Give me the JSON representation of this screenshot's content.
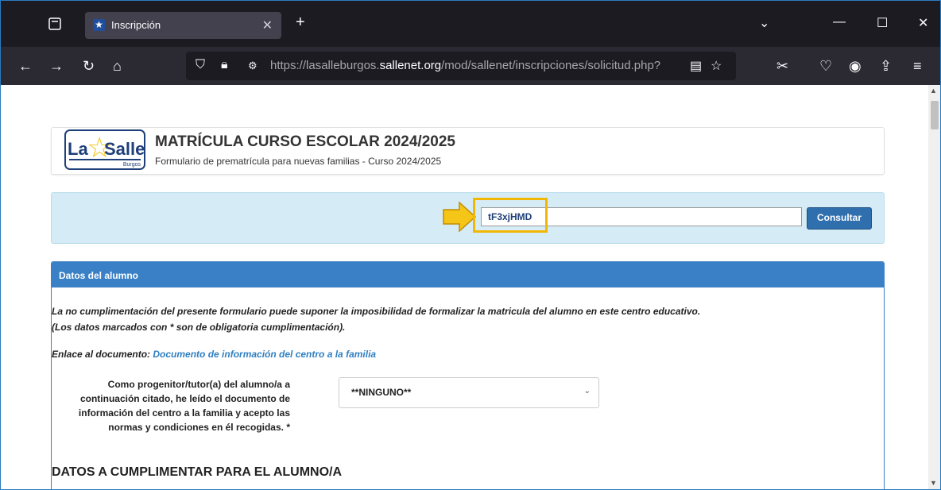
{
  "browser": {
    "tab_title": "Inscripción",
    "tab_favicon": "★",
    "url_prefix": "https://lasalleburgos.",
    "url_domain": "sallenet.org",
    "url_path": "/mod/sallenet/inscripciones/solicitud.php?"
  },
  "header": {
    "logo_la": "La",
    "logo_salle": "Salle",
    "logo_burgos": "Burgos",
    "title": "MATRÍCULA CURSO ESCOLAR 2024/2025",
    "subtitle": "Formulario de prematrícula para nuevas familias - Curso 2024/2025"
  },
  "search": {
    "code_value": "tF3xjHMD",
    "button_label": "Consultar"
  },
  "section": {
    "title": "Datos del alumno",
    "notice_line1": "La no cumplimentación del presente formulario puede suponer la imposibilidad de formalizar la matricula del alumno en este centro educativo.",
    "notice_line2": "(Los datos marcados con * son de obligatoria cumplimentación).",
    "link_prefix": "Enlace al documento: ",
    "link_text": "Documento de información del centro a la familia",
    "consent_label": "Como progenitor/tutor(a) del alumno/a a continuación citado, he leído el documento de información del centro a la familia y acepto las normas y condiciones en él recogidas. *",
    "consent_select_value": "**NINGUNO**",
    "subsection_title": "DATOS A CUMPLIMENTAR PARA EL ALUMNO/A"
  },
  "colors": {
    "accent": "#3a80c6",
    "highlight": "#f2b705",
    "panel_bg": "#d5ecf6"
  }
}
